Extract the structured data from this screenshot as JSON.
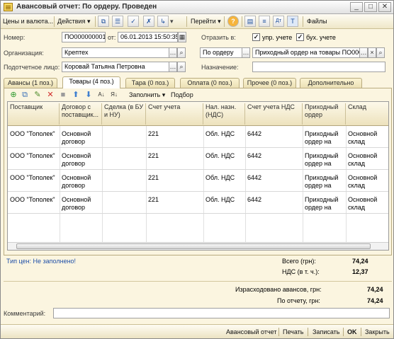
{
  "window": {
    "title": "Авансовый отчет: По ордеру. Проведен",
    "buttons": [
      "_",
      "□",
      "✕"
    ]
  },
  "toolbar": {
    "prices_menu": "Цены и валюта...",
    "actions_menu": "Действия",
    "goto_menu": "Перейти",
    "help_label": "?",
    "files_label": "Файлы"
  },
  "header": {
    "number_label": "Номер:",
    "number_value": "ПО000000001",
    "from_label": "от:",
    "date_value": "06.01.2013 15:50:35",
    "reflect_label": "Отразить в:",
    "mgmt_accounting_label": "упр. учете",
    "mgmt_accounting_checked": true,
    "acct_accounting_label": "бух. учете",
    "acct_accounting_checked": true,
    "org_label": "Организация:",
    "org_value": "Крептех",
    "basis_value": "По ордеру",
    "order_value": "Приходный ордер на товары ПО000(",
    "person_label": "Подотчетное лицо:",
    "person_value": "Коровай Татьяна Петровна",
    "purpose_label": "Назначение:",
    "purpose_value": ""
  },
  "tabs": [
    {
      "label": "Авансы (1 поз.)",
      "active": false
    },
    {
      "label": "Товары (4 поз.)",
      "active": true
    },
    {
      "label": "Тара (0 поз.)",
      "active": false
    },
    {
      "label": "Оплата (0 поз.)",
      "active": false
    },
    {
      "label": "Прочее (0 поз.)",
      "active": false
    },
    {
      "label": "Дополнительно",
      "active": false
    }
  ],
  "table_toolbar": {
    "fill_label": "Заполнить",
    "pick_label": "Подбор"
  },
  "table": {
    "columns": [
      "Поставщик",
      "Договор с поставщик...",
      "Сделка (в БУ и НУ)",
      "Счет учета",
      "Нал. назн. (НДС)",
      "Счет учета НДС",
      "Приходный ордер",
      "Склад"
    ],
    "rows": [
      {
        "c0": "ООО \"Тополек\"",
        "c1a": "Основной",
        "c1b": "договор",
        "c2": "",
        "c3": "221",
        "c4": "Обл. НДС",
        "c5": "6442",
        "c6a": "Приходный",
        "c6b": "ордер на",
        "c7a": "Основной",
        "c7b": "склад"
      },
      {
        "c0": "ООО \"Тополек\"",
        "c1a": "Основной",
        "c1b": "договор",
        "c2": "",
        "c3": "221",
        "c4": "Обл. НДС",
        "c5": "6442",
        "c6a": "Приходный",
        "c6b": "ордер на",
        "c7a": "Основной",
        "c7b": "склад"
      },
      {
        "c0": "ООО \"Тополек\"",
        "c1a": "Основной",
        "c1b": "договор",
        "c2": "",
        "c3": "221",
        "c4": "Обл. НДС",
        "c5": "6442",
        "c6a": "Приходный",
        "c6b": "ордер на",
        "c7a": "Основной",
        "c7b": "склад"
      },
      {
        "c0": "ООО \"Тополек\"",
        "c1a": "Основной",
        "c1b": "договор",
        "c2": "",
        "c3": "221",
        "c4": "Обл. НДС",
        "c5": "6442",
        "c6a": "Приходный",
        "c6b": "ордер на",
        "c7a": "Основной",
        "c7b": "склад"
      }
    ]
  },
  "totals": {
    "price_type_link": "Тип цен: Не заполнено!",
    "total_label": "Всего (грн):",
    "total_value": "74,24",
    "vat_label": "НДС (в т. ч.):",
    "vat_value": "12,37",
    "advances_spent_label": "Израсходовано авансов, грн:",
    "advances_spent_value": "74,24",
    "by_report_label": "По отчету, грн:",
    "by_report_value": "74,24"
  },
  "comment": {
    "label": "Комментарий:",
    "value": ""
  },
  "footer": {
    "report_label": "Авансовый отчет",
    "print_label": "Печать",
    "save_label": "Записать",
    "ok_label": "OK",
    "close_label": "Закрыть"
  },
  "colors": {
    "window_bg": "#fbf5e0",
    "link": "#1f4fa8"
  },
  "icons": [
    "document-icon",
    "new-copy-icon",
    "list-icon",
    "post-icon",
    "unpost-icon",
    "structure-icon",
    "help-icon",
    "settings-icon",
    "dt-kt-icon",
    "columns-icon",
    "add-row-icon",
    "copy-row-icon",
    "edit-row-icon",
    "delete-row-icon",
    "end-edit-icon",
    "move-up-icon",
    "move-down-icon",
    "sort-asc-icon",
    "sort-desc-icon"
  ]
}
